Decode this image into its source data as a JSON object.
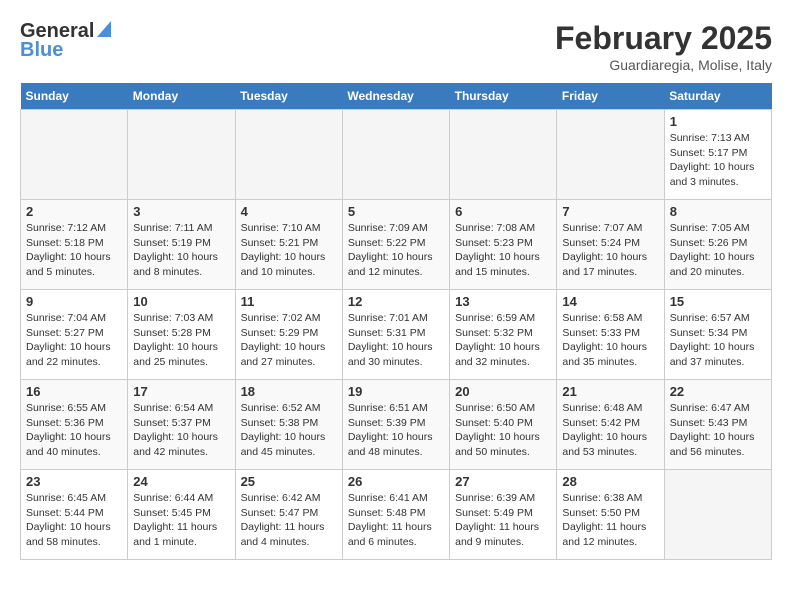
{
  "header": {
    "logo_general": "General",
    "logo_blue": "Blue",
    "month_title": "February 2025",
    "location": "Guardiaregia, Molise, Italy"
  },
  "calendar": {
    "days_of_week": [
      "Sunday",
      "Monday",
      "Tuesday",
      "Wednesday",
      "Thursday",
      "Friday",
      "Saturday"
    ],
    "weeks": [
      [
        {
          "day": "",
          "info": ""
        },
        {
          "day": "",
          "info": ""
        },
        {
          "day": "",
          "info": ""
        },
        {
          "day": "",
          "info": ""
        },
        {
          "day": "",
          "info": ""
        },
        {
          "day": "",
          "info": ""
        },
        {
          "day": "1",
          "info": "Sunrise: 7:13 AM\nSunset: 5:17 PM\nDaylight: 10 hours and 3 minutes."
        }
      ],
      [
        {
          "day": "2",
          "info": "Sunrise: 7:12 AM\nSunset: 5:18 PM\nDaylight: 10 hours and 5 minutes."
        },
        {
          "day": "3",
          "info": "Sunrise: 7:11 AM\nSunset: 5:19 PM\nDaylight: 10 hours and 8 minutes."
        },
        {
          "day": "4",
          "info": "Sunrise: 7:10 AM\nSunset: 5:21 PM\nDaylight: 10 hours and 10 minutes."
        },
        {
          "day": "5",
          "info": "Sunrise: 7:09 AM\nSunset: 5:22 PM\nDaylight: 10 hours and 12 minutes."
        },
        {
          "day": "6",
          "info": "Sunrise: 7:08 AM\nSunset: 5:23 PM\nDaylight: 10 hours and 15 minutes."
        },
        {
          "day": "7",
          "info": "Sunrise: 7:07 AM\nSunset: 5:24 PM\nDaylight: 10 hours and 17 minutes."
        },
        {
          "day": "8",
          "info": "Sunrise: 7:05 AM\nSunset: 5:26 PM\nDaylight: 10 hours and 20 minutes."
        }
      ],
      [
        {
          "day": "9",
          "info": "Sunrise: 7:04 AM\nSunset: 5:27 PM\nDaylight: 10 hours and 22 minutes."
        },
        {
          "day": "10",
          "info": "Sunrise: 7:03 AM\nSunset: 5:28 PM\nDaylight: 10 hours and 25 minutes."
        },
        {
          "day": "11",
          "info": "Sunrise: 7:02 AM\nSunset: 5:29 PM\nDaylight: 10 hours and 27 minutes."
        },
        {
          "day": "12",
          "info": "Sunrise: 7:01 AM\nSunset: 5:31 PM\nDaylight: 10 hours and 30 minutes."
        },
        {
          "day": "13",
          "info": "Sunrise: 6:59 AM\nSunset: 5:32 PM\nDaylight: 10 hours and 32 minutes."
        },
        {
          "day": "14",
          "info": "Sunrise: 6:58 AM\nSunset: 5:33 PM\nDaylight: 10 hours and 35 minutes."
        },
        {
          "day": "15",
          "info": "Sunrise: 6:57 AM\nSunset: 5:34 PM\nDaylight: 10 hours and 37 minutes."
        }
      ],
      [
        {
          "day": "16",
          "info": "Sunrise: 6:55 AM\nSunset: 5:36 PM\nDaylight: 10 hours and 40 minutes."
        },
        {
          "day": "17",
          "info": "Sunrise: 6:54 AM\nSunset: 5:37 PM\nDaylight: 10 hours and 42 minutes."
        },
        {
          "day": "18",
          "info": "Sunrise: 6:52 AM\nSunset: 5:38 PM\nDaylight: 10 hours and 45 minutes."
        },
        {
          "day": "19",
          "info": "Sunrise: 6:51 AM\nSunset: 5:39 PM\nDaylight: 10 hours and 48 minutes."
        },
        {
          "day": "20",
          "info": "Sunrise: 6:50 AM\nSunset: 5:40 PM\nDaylight: 10 hours and 50 minutes."
        },
        {
          "day": "21",
          "info": "Sunrise: 6:48 AM\nSunset: 5:42 PM\nDaylight: 10 hours and 53 minutes."
        },
        {
          "day": "22",
          "info": "Sunrise: 6:47 AM\nSunset: 5:43 PM\nDaylight: 10 hours and 56 minutes."
        }
      ],
      [
        {
          "day": "23",
          "info": "Sunrise: 6:45 AM\nSunset: 5:44 PM\nDaylight: 10 hours and 58 minutes."
        },
        {
          "day": "24",
          "info": "Sunrise: 6:44 AM\nSunset: 5:45 PM\nDaylight: 11 hours and 1 minute."
        },
        {
          "day": "25",
          "info": "Sunrise: 6:42 AM\nSunset: 5:47 PM\nDaylight: 11 hours and 4 minutes."
        },
        {
          "day": "26",
          "info": "Sunrise: 6:41 AM\nSunset: 5:48 PM\nDaylight: 11 hours and 6 minutes."
        },
        {
          "day": "27",
          "info": "Sunrise: 6:39 AM\nSunset: 5:49 PM\nDaylight: 11 hours and 9 minutes."
        },
        {
          "day": "28",
          "info": "Sunrise: 6:38 AM\nSunset: 5:50 PM\nDaylight: 11 hours and 12 minutes."
        },
        {
          "day": "",
          "info": ""
        }
      ]
    ]
  }
}
